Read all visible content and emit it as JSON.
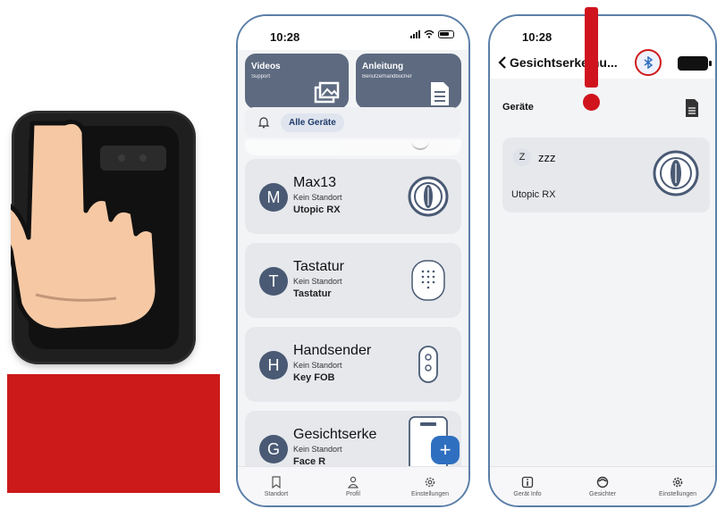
{
  "phone_a": {
    "status_time": "10:28",
    "header_cards": [
      {
        "title": "Videos",
        "subtitle": "Support"
      },
      {
        "title": "Anleitung",
        "subtitle": "Benutzerhandbücher"
      }
    ],
    "filter_chip": "Alle Geräte",
    "devices": [
      {
        "initial": "M",
        "name": "Max13",
        "location": "Kein Standort",
        "type": "Utopic RX",
        "icon": "lock-icon"
      },
      {
        "initial": "T",
        "name": "Tastatur",
        "location": "Kein Standort",
        "type": "Tastatur",
        "icon": "keypad-icon"
      },
      {
        "initial": "H",
        "name": "Handsender",
        "location": "Kein Standort",
        "type": "Key FOB",
        "icon": "keyfob-icon"
      },
      {
        "initial": "G",
        "name": "Gesichtserke",
        "location": "Kein Standort",
        "type": "Face R",
        "icon": "face-reader-icon"
      }
    ],
    "fab_label": "+",
    "tabs": [
      {
        "label": "Standort",
        "icon": "bookmark-icon"
      },
      {
        "label": "Profil",
        "icon": "person-icon"
      },
      {
        "label": "Einstellungen",
        "icon": "gear-icon"
      }
    ]
  },
  "phone_b": {
    "status_time": "10:28",
    "title": "Gesichtserke nu...",
    "section": "Geräte",
    "device": {
      "badge": "Z",
      "name": "zzz",
      "type": "Utopic RX"
    },
    "tabs": [
      {
        "label": "Gerät Info",
        "icon": "info-icon"
      },
      {
        "label": "Gesichter",
        "icon": "face-icon"
      },
      {
        "label": "Einstellungen",
        "icon": "gear-icon"
      }
    ]
  },
  "colors": {
    "alert_red": "#d0141e",
    "accent_blue": "#2f6fc0",
    "card_dark": "#5d6a80"
  }
}
